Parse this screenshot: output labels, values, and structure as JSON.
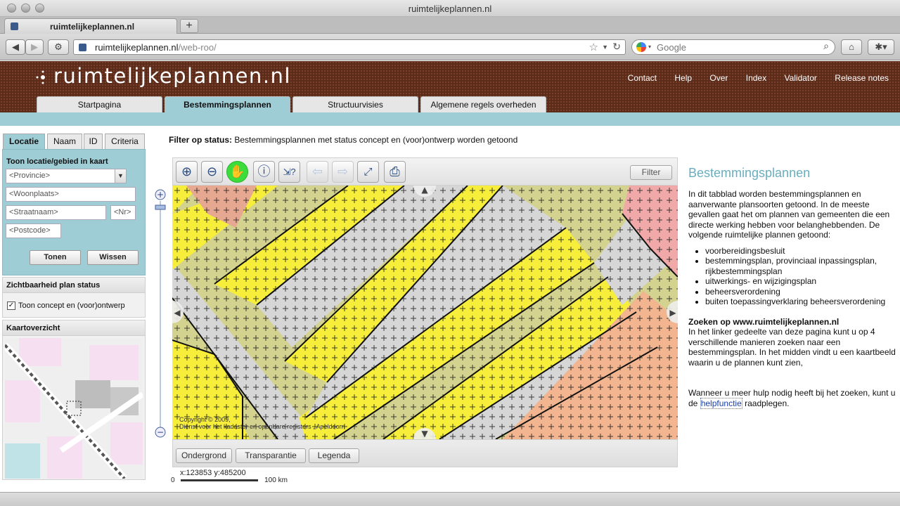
{
  "browser": {
    "window_title": "ruimtelijkeplannen.nl",
    "tab_title": "ruimtelijkeplannen.nl",
    "url_domain": "ruimtelijkeplannen.nl",
    "url_path": "/web-roo/",
    "search_placeholder": "Google"
  },
  "site": {
    "logo": "ruimtelijkeplannen.nl",
    "top_links": [
      "Contact",
      "Help",
      "Over",
      "Index",
      "Validator",
      "Release notes"
    ],
    "main_tabs": [
      "Startpagina",
      "Bestemmingsplannen",
      "Structuurvisies",
      "Algemene regels overheden"
    ],
    "active_tab": "Bestemmingsplannen"
  },
  "left": {
    "tabs": [
      "Locatie",
      "Naam",
      "ID",
      "Criteria"
    ],
    "heading": "Toon locatie/gebied in kaart",
    "provincie": "<Provincie>",
    "woonplaats": "<Woonplaats>",
    "straatnaam": "<Straatnaam>",
    "nr": "<Nr>",
    "postcode": "<Postcode>",
    "btn_tonen": "Tonen",
    "btn_wissen": "Wissen",
    "zicht_title": "Zichtbaarheid plan status",
    "zicht_checkbox": "Toon concept en (voor)ontwerp",
    "zicht_checked": true,
    "kaart_title": "Kaartoverzicht"
  },
  "center": {
    "filter_label": "Filter op status:",
    "filter_text": "Bestemmingsplannen met status concept en (voor)ontwerp worden getoond",
    "filter_btn": "Filter",
    "tools": [
      "zoom-in-icon",
      "zoom-out-icon",
      "pan-hand-icon",
      "info-icon",
      "measure-icon",
      "back-icon",
      "forward-icon",
      "full-extent-icon",
      "print-icon"
    ],
    "copyright1": "Copyright © 2009,",
    "copyright2": "Dienst voor het kadaster en openbare registers , Apeldoorn",
    "bottom_buttons": [
      "Ondergrond",
      "Transparantie",
      "Legenda"
    ],
    "coords": "x:123853 y:485200",
    "scale_left": "0",
    "scale_right": "100 km"
  },
  "right": {
    "title": "Bestemmingsplannen",
    "intro": "In dit tabblad worden bestemmingsplannen en aanverwante plansoorten getoond. In de meeste gevallen gaat het om plannen van gemeenten die een directe werking hebben voor belanghebbenden. De volgende ruimtelijke plannen getoond:",
    "items": [
      "voorbereidingsbesluit",
      "bestemmingsplan, provinciaal inpassingsplan, rijkbestemmingsplan",
      "uitwerkings- en wijzigingsplan",
      "beheersverordening",
      "buiten toepassingverklaring beheersverordening"
    ],
    "search_title": "Zoeken op www.ruimtelijkeplannen.nl",
    "search_text": "In het linker gedeelte van deze pagina kunt u op 4 verschillende manieren zoeken naar een bestemmingsplan. In het midden vindt u een kaartbeeld waarin u de plannen kunt zien,",
    "help_pre": "Wanneer u meer hulp nodig heeft bij het zoeken, kunt u de",
    "help_link": "helpfunctie",
    "help_post": "raadplegen."
  },
  "colors": {
    "brown_header": "#5b2b1a",
    "teal": "#9fcdd6",
    "map_yellow": "#f6ee3a",
    "map_olive": "#d3d28e",
    "map_grey": "#d6d6d6",
    "map_salmon": "#f2b58f",
    "map_pink": "#f0a8a8"
  }
}
